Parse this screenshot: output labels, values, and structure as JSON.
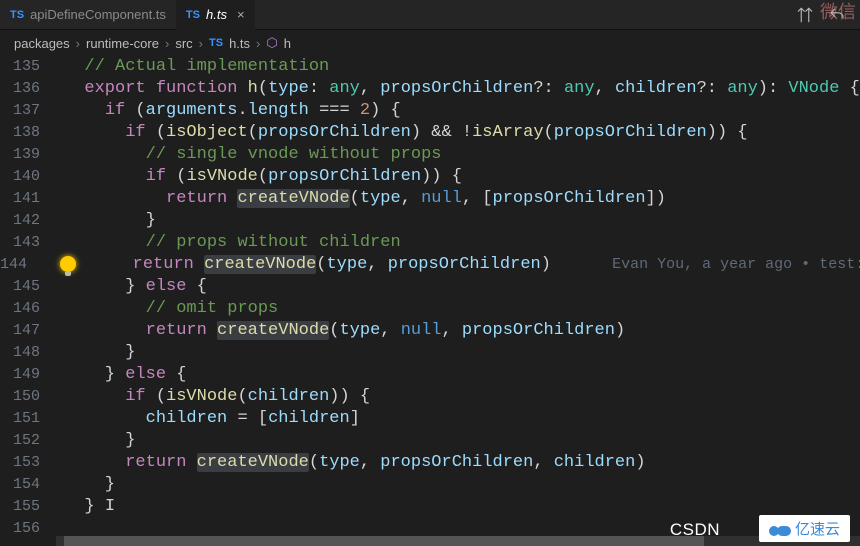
{
  "tabs": [
    {
      "icon": "TS",
      "label": "apiDefineComponent.ts",
      "active": false
    },
    {
      "icon": "TS",
      "label": "h.ts",
      "active": true
    }
  ],
  "breadcrumb": {
    "p0": "packages",
    "p1": "runtime-core",
    "p2": "src",
    "fileIcon": "TS",
    "file": "h.ts",
    "symbol": "h"
  },
  "gitlens": {
    "text": "Evan You, a year ago • test: upda"
  },
  "code": [
    {
      "n": "135",
      "html": "  <span class='cm'>// Actual implementation</span>"
    },
    {
      "n": "136",
      "html": "  <span class='kw'>export</span> <span class='kw'>function</span> <span class='fn'>h</span>(<span class='id'>type</span>: <span class='ty'>any</span>, <span class='id'>propsOrChildren</span>?: <span class='ty'>any</span>, <span class='id'>children</span>?: <span class='ty'>any</span>): <span class='ty'>VNode</span> {"
    },
    {
      "n": "137",
      "html": "    <span class='kw'>if</span> (<span class='id'>arguments</span>.<span class='id'>length</span> === <span class='st'>2</span>) {"
    },
    {
      "n": "138",
      "html": "      <span class='kw'>if</span> (<span class='fn'>isObject</span>(<span class='id'>propsOrChildren</span>) && !<span class='fn'>isArray</span>(<span class='id'>propsOrChildren</span>)) {"
    },
    {
      "n": "139",
      "html": "        <span class='cm'>// single vnode without props</span>"
    },
    {
      "n": "140",
      "html": "        <span class='kw'>if</span> (<span class='fn'>isVNode</span>(<span class='id'>propsOrChildren</span>)) {"
    },
    {
      "n": "141",
      "html": "          <span class='kw'>return</span> <span class='fn sel'>createVNode</span>(<span class='id'>type</span>, <span class='nul'>null</span>, [<span class='id'>propsOrChildren</span>])"
    },
    {
      "n": "142",
      "html": "        }"
    },
    {
      "n": "143",
      "html": "        <span class='cm'>// props without children</span>"
    },
    {
      "n": "144",
      "html": "        <span class='kw'>return</span> <span class='fn sel'>createVNode</span>(<span class='id'>type</span>, <span class='id'>propsOrChildren</span>)      <span class='lens'>Evan You, a year ago • test: upda</span>"
    },
    {
      "n": "145",
      "html": "      } <span class='kw'>else</span> {"
    },
    {
      "n": "146",
      "html": "        <span class='cm'>// omit props</span>"
    },
    {
      "n": "147",
      "html": "        <span class='kw'>return</span> <span class='fn sel'>createVNode</span>(<span class='id'>type</span>, <span class='nul'>null</span>, <span class='id'>propsOrChildren</span>)"
    },
    {
      "n": "148",
      "html": "      }"
    },
    {
      "n": "149",
      "html": "    } <span class='kw'>else</span> {"
    },
    {
      "n": "150",
      "html": "      <span class='kw'>if</span> (<span class='fn'>isVNode</span>(<span class='id'>children</span>)) {"
    },
    {
      "n": "151",
      "html": "        <span class='id'>children</span> = [<span class='id'>children</span>]"
    },
    {
      "n": "152",
      "html": "      }"
    },
    {
      "n": "153",
      "html": "      <span class='kw'>return</span> <span class='fn sel'>createVNode</span>(<span class='id'>type</span>, <span class='id'>propsOrChildren</span>, <span class='id'>children</span>)"
    },
    {
      "n": "154",
      "html": "    }"
    },
    {
      "n": "155",
      "html": "  } <span class='op'>I</span>"
    },
    {
      "n": "156",
      "html": ""
    }
  ],
  "watermarks": {
    "csdn": "CSDN",
    "yisu": "亿速云",
    "wx": "微信"
  }
}
